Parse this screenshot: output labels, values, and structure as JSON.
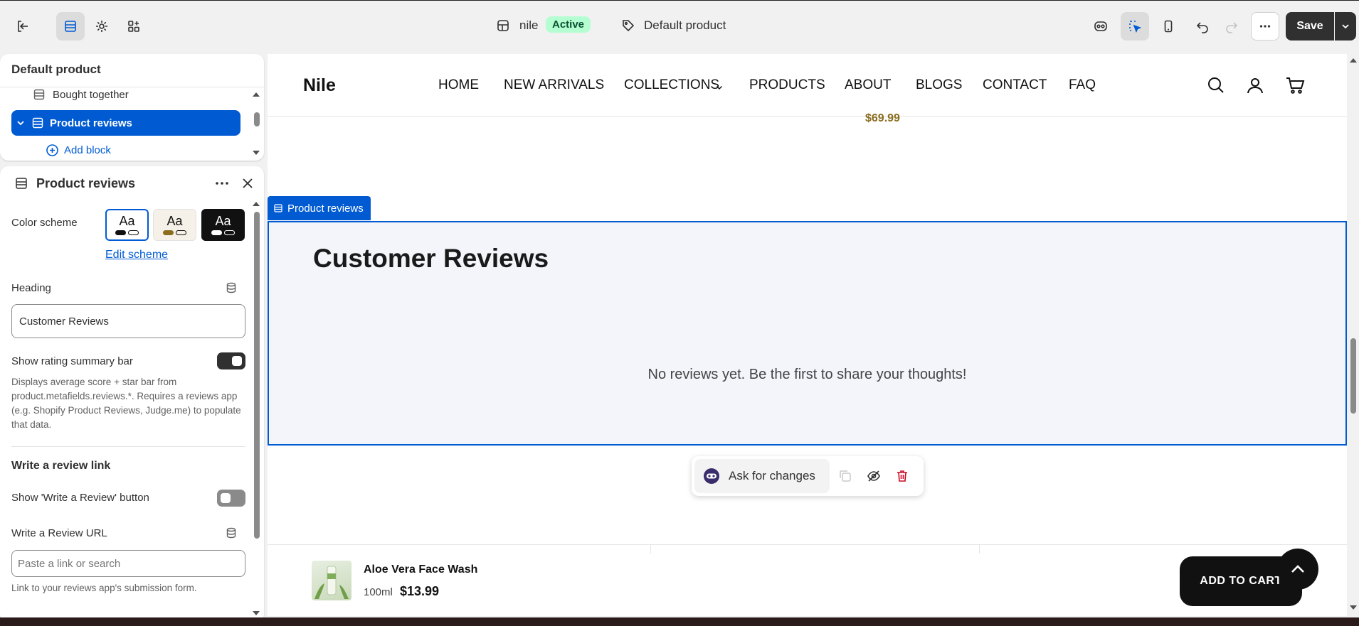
{
  "topbar": {
    "store_name": "nile",
    "store_status": "Active",
    "template_name": "Default product",
    "save_label": "Save"
  },
  "tree": {
    "title": "Default product",
    "items": [
      {
        "label": "Bought together"
      },
      {
        "label": "Product reviews"
      }
    ],
    "add_block_label": "Add block"
  },
  "settings": {
    "title": "Product reviews",
    "color_scheme_label": "Color scheme",
    "scheme_sample": "Aa",
    "edit_scheme_label": "Edit scheme",
    "heading_label": "Heading",
    "heading_value": "Customer Reviews",
    "rating_bar_label": "Show rating summary bar",
    "rating_bar_help": "Displays average score + star bar from product.metafields.reviews.*. Requires a reviews app (e.g. Shopify Product Reviews, Judge.me) to populate that data.",
    "write_review_section": "Write a review link",
    "show_write_button_label": "Show 'Write a Review' button",
    "review_url_label": "Write a Review URL",
    "review_url_placeholder": "Paste a link or search",
    "review_url_help": "Link to your reviews app's submission form."
  },
  "site": {
    "logo": "Nile",
    "nav": [
      "HOME",
      "NEW ARRIVALS",
      "COLLECTIONS",
      "PRODUCTS",
      "ABOUT",
      "BLOGS",
      "CONTACT",
      "FAQ"
    ],
    "price_fragment": "$69.99"
  },
  "preview": {
    "section_tab": "Product reviews",
    "reviews_heading": "Customer Reviews",
    "reviews_empty": "No reviews yet. Be the first to share your thoughts!",
    "ask_label": "Ask for changes"
  },
  "sticky": {
    "product_name": "Aloe Vera Face Wash",
    "variant": "100ml",
    "price": "$13.99",
    "add_to_cart": "ADD TO CART"
  },
  "colors": {
    "accent": "#005bd3",
    "save_bg": "#303030",
    "active_badge_bg": "#b4fed2",
    "price_gold": "#8a6d1e"
  }
}
